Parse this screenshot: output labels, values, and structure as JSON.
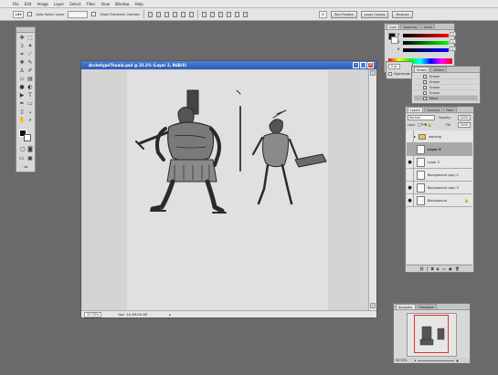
{
  "menu": [
    "File",
    "Edit",
    "Image",
    "Layer",
    "Select",
    "Filter",
    "View",
    "Window",
    "Help"
  ],
  "options_bar": {
    "auto_select": "Auto Select Layer",
    "show_transform": "Show Transform Controls",
    "workspace_buttons": [
      "Tool Presets",
      "Layer Comps",
      "Brushes"
    ]
  },
  "document": {
    "title": "ArchetypeThumb.psd @ 33.3% (Layer 2, RGB/8)",
    "zoom": "33.33%",
    "doc_size": "Doc: 16.3M/16.3M"
  },
  "color_panel": {
    "tabs": [
      "Color",
      "Swatches",
      "Styles"
    ],
    "channels": [
      {
        "label": "R",
        "value": "0"
      },
      {
        "label": "G",
        "value": "0"
      },
      {
        "label": "B",
        "value": "0"
      }
    ]
  },
  "info_panel": {
    "zoom_field": "0 pt",
    "check_label": "Hyphenate"
  },
  "history_panel": {
    "tabs": [
      "History",
      "Actions"
    ],
    "items": [
      "Eraser",
      "Eraser",
      "Eraser",
      "Eraser",
      "Move"
    ]
  },
  "layers_panel": {
    "tabs": [
      "Layers",
      "Channels",
      "Paths"
    ],
    "blend_mode": "Normal",
    "opacity_label": "Opacity:",
    "opacity_value": "100%",
    "lock_label": "Lock:",
    "fill_label": "Fill:",
    "fill_value": "100%",
    "layers": [
      {
        "name": "working",
        "type": "folder",
        "visible": false,
        "selected": false
      },
      {
        "name": "Layer 3",
        "type": "layer",
        "visible": false,
        "selected": true
      },
      {
        "name": "Layer 2",
        "type": "layer",
        "visible": true,
        "selected": false
      },
      {
        "name": "Background copy 2",
        "type": "layer",
        "visible": false,
        "selected": false
      },
      {
        "name": "Background copy 3",
        "type": "layer",
        "visible": true,
        "selected": false
      },
      {
        "name": "Background",
        "type": "layer",
        "visible": true,
        "selected": false,
        "locked": true
      }
    ]
  },
  "navigator_panel": {
    "tabs": [
      "Navigator",
      "Histogram"
    ],
    "zoom": "33.33%"
  },
  "colors": {
    "titlebar": "#2a5bb8",
    "accent_red": "#e03030"
  }
}
